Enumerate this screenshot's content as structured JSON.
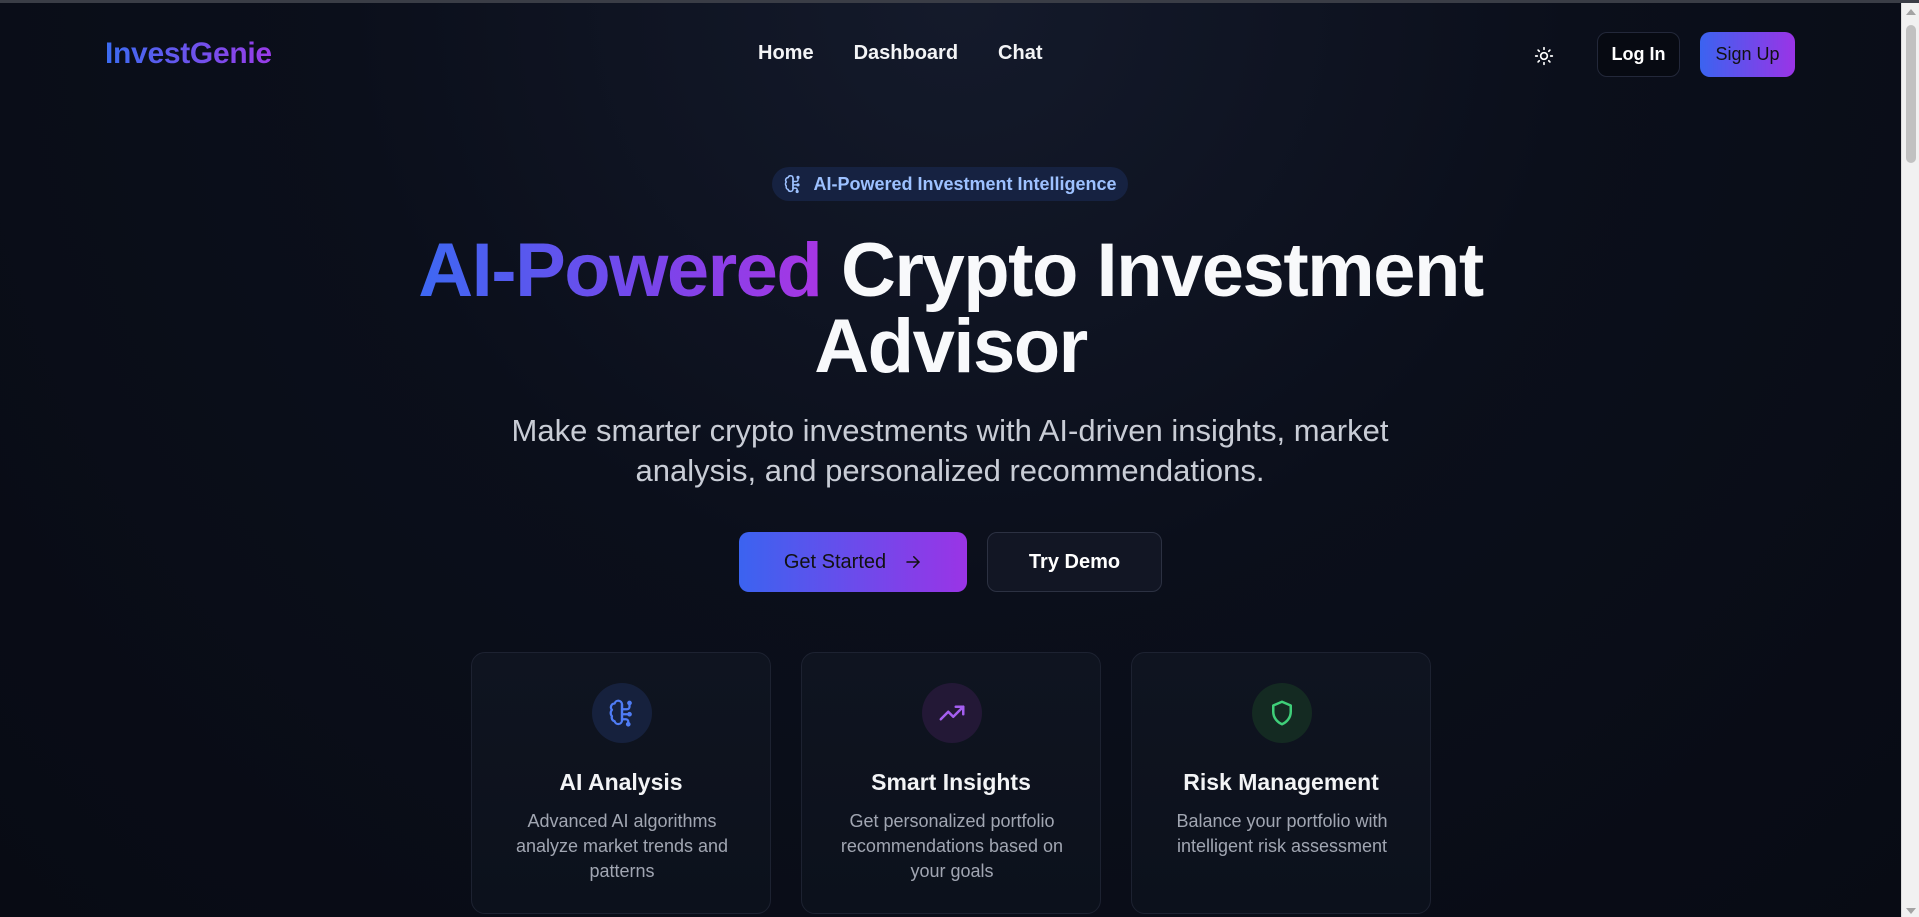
{
  "nav": {
    "logo": "InvestGenie",
    "links": [
      "Home",
      "Dashboard",
      "Chat"
    ],
    "login_label": "Log In",
    "signup_label": "Sign Up",
    "theme_icon": "sun-icon"
  },
  "hero": {
    "badge": "AI-Powered Investment Intelligence",
    "badge_icon": "brain-icon",
    "title_highlight": "AI-Powered",
    "title_rest": "Crypto Investment",
    "title_line2": "Advisor",
    "subtitle": "Make smarter crypto investments with AI-driven insights, market analysis, and personalized recommendations.",
    "primary_cta": "Get Started",
    "secondary_cta": "Try Demo"
  },
  "features": [
    {
      "icon": "brain-icon",
      "title": "AI Analysis",
      "description": "Advanced AI algorithms analyze market trends and patterns",
      "color": "#4f7cf5"
    },
    {
      "icon": "trending-up-icon",
      "title": "Smart Insights",
      "description": "Get personalized portfolio recommendations based on your goals",
      "color": "#a45ef0"
    },
    {
      "icon": "shield-icon",
      "title": "Risk Management",
      "description": "Balance your portfolio with intelligent risk assessment",
      "color": "#3fcf79"
    }
  ],
  "colors": {
    "background": "#0a0d17",
    "gradient_start": "#3b63f0",
    "gradient_end": "#9a34e6"
  }
}
